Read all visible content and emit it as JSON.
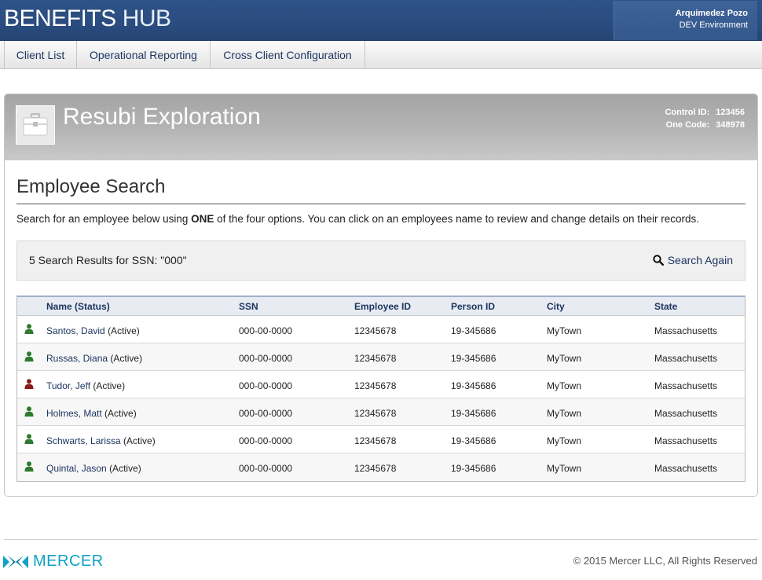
{
  "header": {
    "brand_primary": "BENEFITS",
    "brand_secondary": "HUB",
    "user_name": "Arquimedez Pozo",
    "environment": "DEV Environment"
  },
  "nav": {
    "items": [
      {
        "label": "Client List"
      },
      {
        "label": "Operational Reporting"
      },
      {
        "label": "Cross Client Configuration"
      }
    ]
  },
  "client": {
    "icon": "briefcase-icon",
    "name": "Resubi Exploration",
    "control_id_label": "Control ID:",
    "control_id": "123456",
    "one_code_label": "One Code:",
    "one_code": "348978"
  },
  "employee_search": {
    "title": "Employee Search",
    "instructions_pre": "Search for an employee below using ",
    "instructions_bold": "ONE",
    "instructions_post": " of the four options. You can click on an employees name to review and change details on their records.",
    "results_text": "5 Search Results for SSN: \"000\"",
    "search_again_label": "Search Again",
    "search_again_icon": "search-icon"
  },
  "table": {
    "headers": [
      "Name (Status)",
      "SSN",
      "Employee ID",
      "Person ID",
      "City",
      "State"
    ],
    "rows": [
      {
        "name": "Santos, David",
        "status": "(Active)",
        "ssn": "000-00-0000",
        "employee_id": "12345678",
        "person_id": "19-345686",
        "city": "MyTown",
        "state": "Massachusetts",
        "icon_color": "#2e7a2e"
      },
      {
        "name": "Russas, Diana",
        "status": "(Active)",
        "ssn": "000-00-0000",
        "employee_id": "12345678",
        "person_id": "19-345686",
        "city": "MyTown",
        "state": "Massachusetts",
        "icon_color": "#2e7a2e"
      },
      {
        "name": "Tudor, Jeff",
        "status": "(Active)",
        "ssn": "000-00-0000",
        "employee_id": "12345678",
        "person_id": "19-345686",
        "city": "MyTown",
        "state": "Massachusetts",
        "icon_color": "#8b1a1a"
      },
      {
        "name": "Holmes, Matt",
        "status": "(Active)",
        "ssn": "000-00-0000",
        "employee_id": "12345678",
        "person_id": "19-345686",
        "city": "MyTown",
        "state": "Massachusetts",
        "icon_color": "#2e7a2e"
      },
      {
        "name": "Schwarts, Larissa",
        "status": "(Active)",
        "ssn": "000-00-0000",
        "employee_id": "12345678",
        "person_id": "19-345686",
        "city": "MyTown",
        "state": "Massachusetts",
        "icon_color": "#2e7a2e"
      },
      {
        "name": "Quintal, Jason",
        "status": "(Active)",
        "ssn": "000-00-0000",
        "employee_id": "12345678",
        "person_id": "19-345686",
        "city": "MyTown",
        "state": "Massachusetts",
        "icon_color": "#2e7a2e"
      }
    ]
  },
  "footer": {
    "logo_text": "MERCER",
    "logo_icon": "mercer-logo-icon",
    "copyright": "© 2015 Mercer LLC, All Rights Reserved"
  },
  "colors": {
    "header_blue": "#2a4c7f",
    "link_navy": "#1c3560",
    "active_green": "#2e7a2e",
    "flag_red": "#8b1a1a",
    "mercer_teal": "#0fa3c4"
  }
}
